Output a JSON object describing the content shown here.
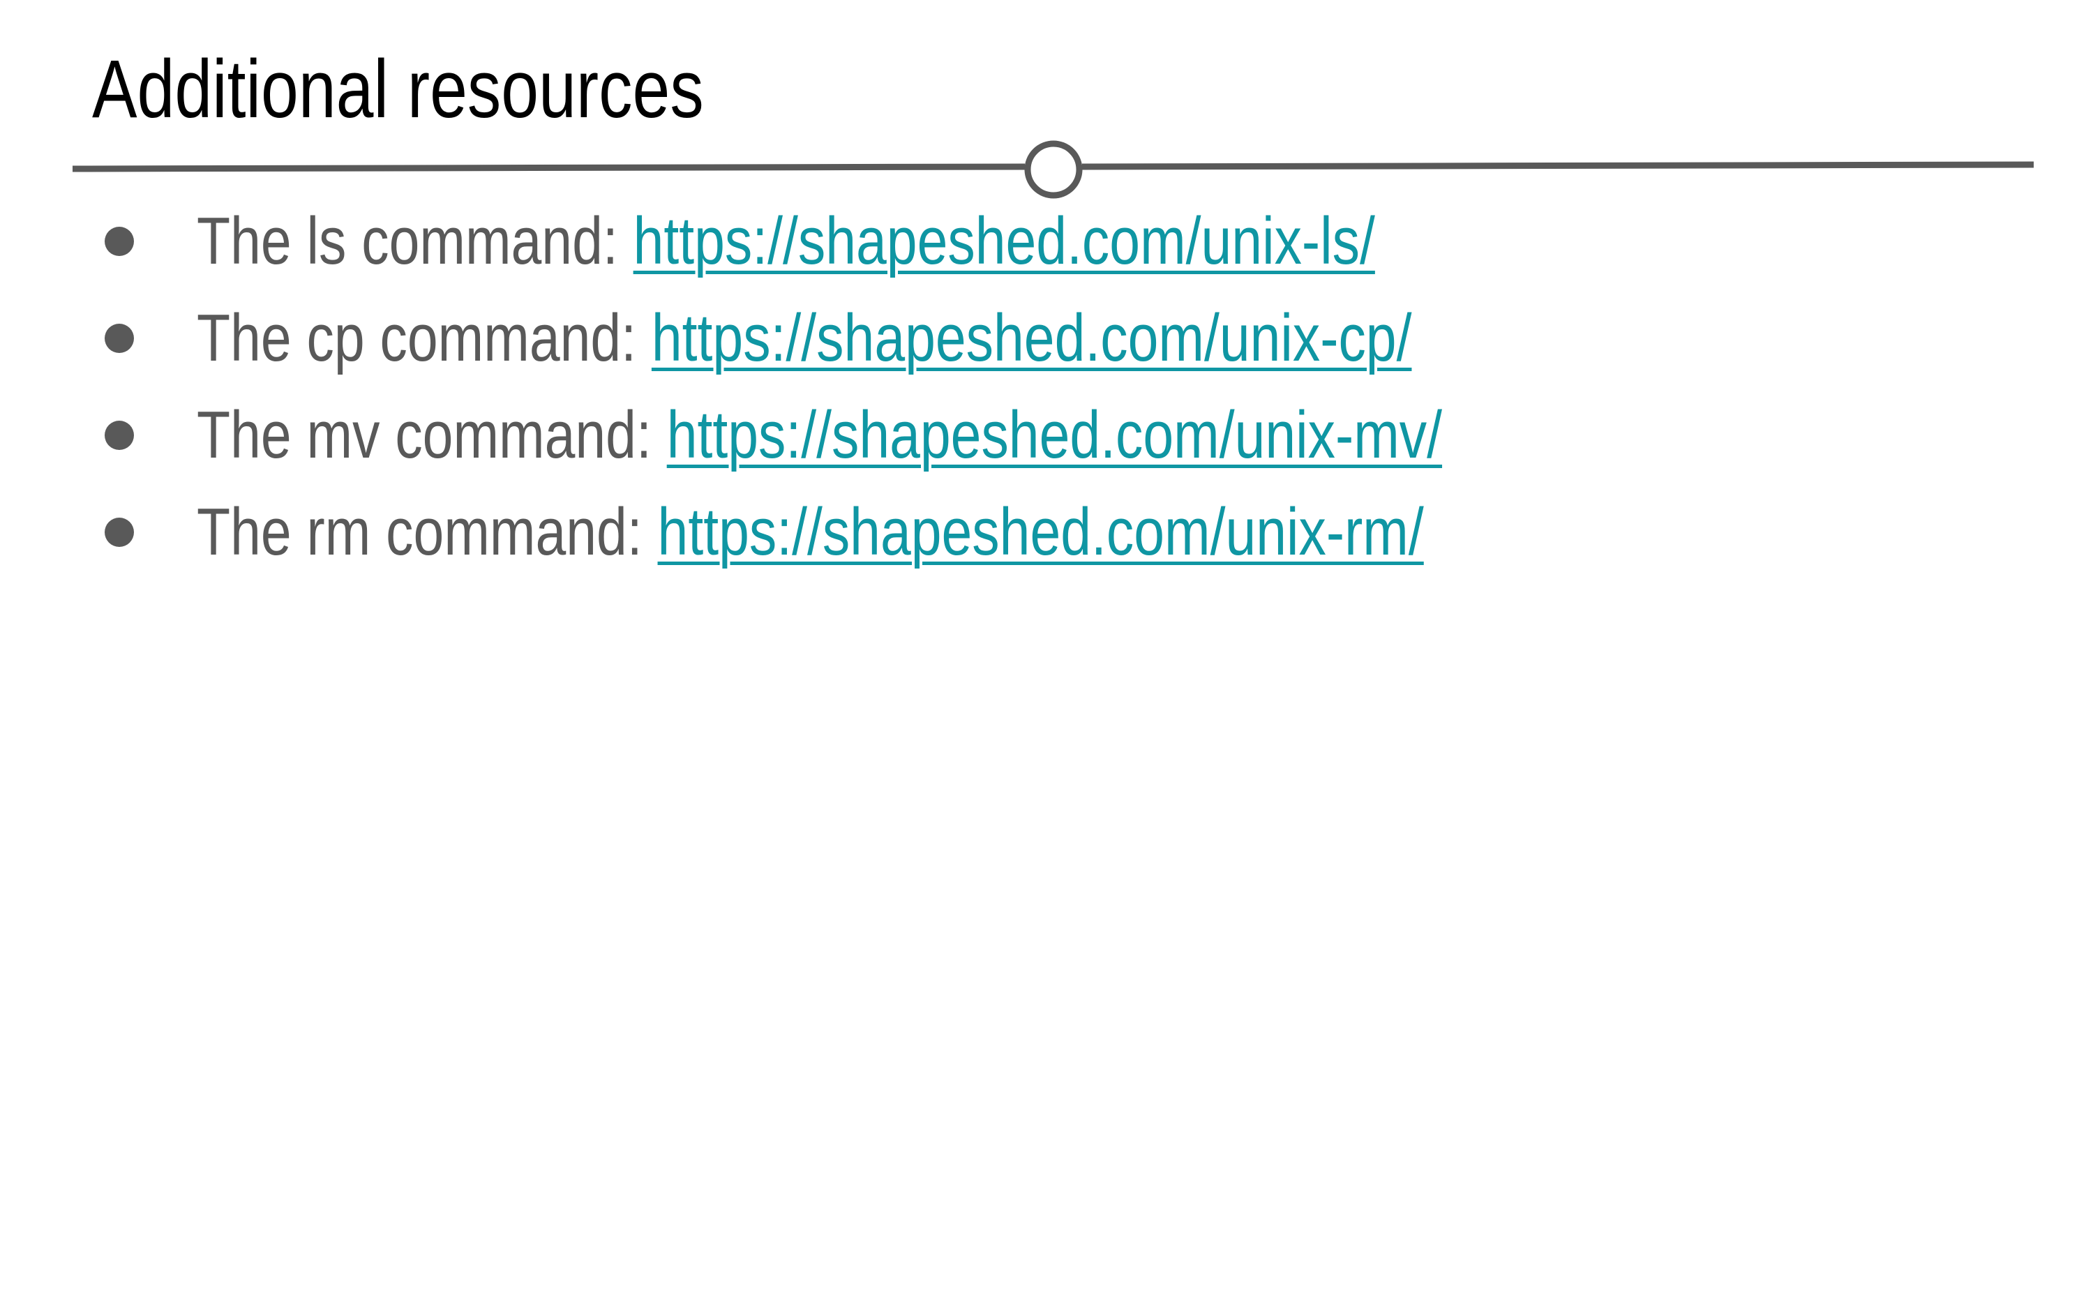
{
  "slide": {
    "title": "Additional resources",
    "items": [
      {
        "label": "The ls command: ",
        "link": "https://shapeshed.com/unix-ls/"
      },
      {
        "label": "The cp command: ",
        "link": "https://shapeshed.com/unix-cp/"
      },
      {
        "label": "The mv command: ",
        "link": "https://shapeshed.com/unix-mv/"
      },
      {
        "label": "The rm command: ",
        "link": "https://shapeshed.com/unix-rm/"
      }
    ]
  },
  "colors": {
    "title": "#000000",
    "body_text": "#595959",
    "link": "#0f96a3",
    "rule": "#595959",
    "background": "#ffffff"
  }
}
